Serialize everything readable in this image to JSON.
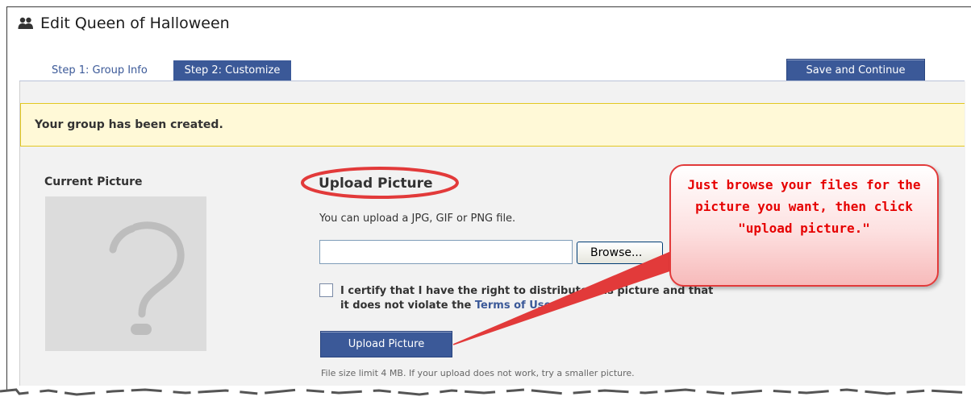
{
  "header": {
    "title": "Edit Queen of Halloween",
    "icon": "group-icon"
  },
  "tabs": [
    {
      "label": "Step 1: Group Info",
      "active": false
    },
    {
      "label": "Step 2: Customize",
      "active": true
    }
  ],
  "toolbar": {
    "save_label": "Save and Continue"
  },
  "notice": {
    "text": "Your group has been created."
  },
  "current_picture": {
    "label": "Current Picture",
    "placeholder_icon": "question-mark-icon"
  },
  "upload": {
    "heading": "Upload Picture",
    "description": "You can upload a JPG, GIF or PNG file.",
    "file_value": "",
    "browse_label": "Browse...",
    "certify_text": "I certify that I have the right to distribute this picture and that it does not violate the ",
    "terms_link": "Terms of Use",
    "certify_end": ".",
    "certify_checked": false,
    "button_label": "Upload Picture",
    "size_note": "File size limit 4 MB. If your upload does not work, try a smaller picture."
  },
  "annotation": {
    "callout_text": "Just browse your files for the picture you want, then click \"upload picture.\""
  },
  "colors": {
    "brand_blue": "#3b5998",
    "notice_bg": "#fff9d7",
    "notice_border": "#e2c822",
    "callout_red": "#e60000"
  }
}
